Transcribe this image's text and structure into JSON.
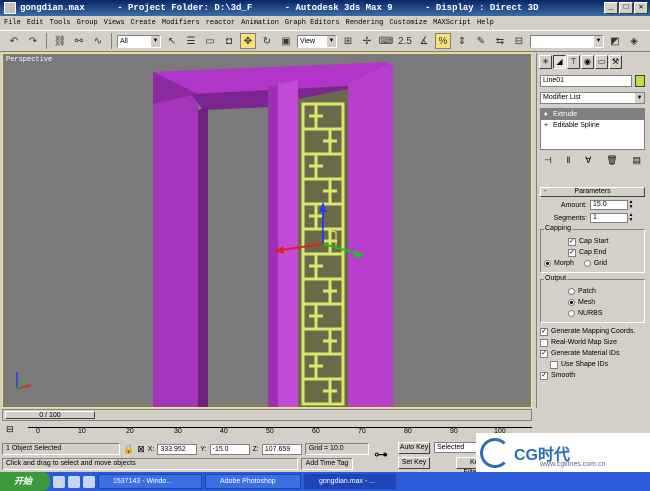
{
  "window": {
    "title": "gongdian.max      - Project Folder: D:\\3d_F      - Autodesk 3ds Max 9      - Display : Direct 3D"
  },
  "menu": [
    "File",
    "Edit",
    "Tools",
    "Group",
    "Views",
    "Create",
    "Modifiers",
    "reactor",
    "Animation",
    "Graph Editors",
    "Rendering",
    "Customize",
    "MAXScript",
    "Help"
  ],
  "toolbar": {
    "selection_filter": "All",
    "reference_coord": "View"
  },
  "viewport": {
    "label": "Perspective"
  },
  "command_panel": {
    "object_name": "Line01",
    "modifier_list": "Modifier List",
    "stack": [
      "Extrude",
      "Editable Spline"
    ],
    "parameters_title": "Parameters",
    "amount_label": "Amount:",
    "amount_value": "15.0",
    "segments_label": "Segments:",
    "segments_value": "1",
    "capping_title": "Capping",
    "cap_start": "Cap Start",
    "cap_end": "Cap End",
    "morph": "Morph",
    "grid": "Grid",
    "output_title": "Output",
    "patch": "Patch",
    "mesh": "Mesh",
    "nurbs": "NURBS",
    "gen_mapping": "Generate Mapping Coords.",
    "real_world": "Real-World Map Size",
    "gen_material": "Generate Material IDs",
    "use_shape": "Use Shape IDs",
    "smooth": "Smooth"
  },
  "timeline": {
    "frame": "0 / 100",
    "ticks": [
      "0",
      "10",
      "20",
      "30",
      "40",
      "50",
      "60",
      "70",
      "80",
      "90",
      "100"
    ]
  },
  "status": {
    "selection": "1 Object Selected",
    "x_label": "X:",
    "x_value": "333.952",
    "y_label": "Y:",
    "y_value": "-15.0",
    "z_label": "Z:",
    "z_value": "107.659",
    "grid": "Grid = 10.0",
    "prompt": "Click and drag to select and move objects",
    "add_time_tag": "Add Time Tag",
    "auto_key": "Auto Key",
    "set_key": "Set Key",
    "selected": "Selected",
    "key_filters": "Key Filters..."
  },
  "watermark": {
    "text": "CG时代",
    "sub": "www.cgtimes.com.cn"
  },
  "taskbar": {
    "start": "开始",
    "tasks": [
      "1537143 - Windo...",
      "Adobe Photoshop",
      "gongdian.max - ..."
    ]
  }
}
